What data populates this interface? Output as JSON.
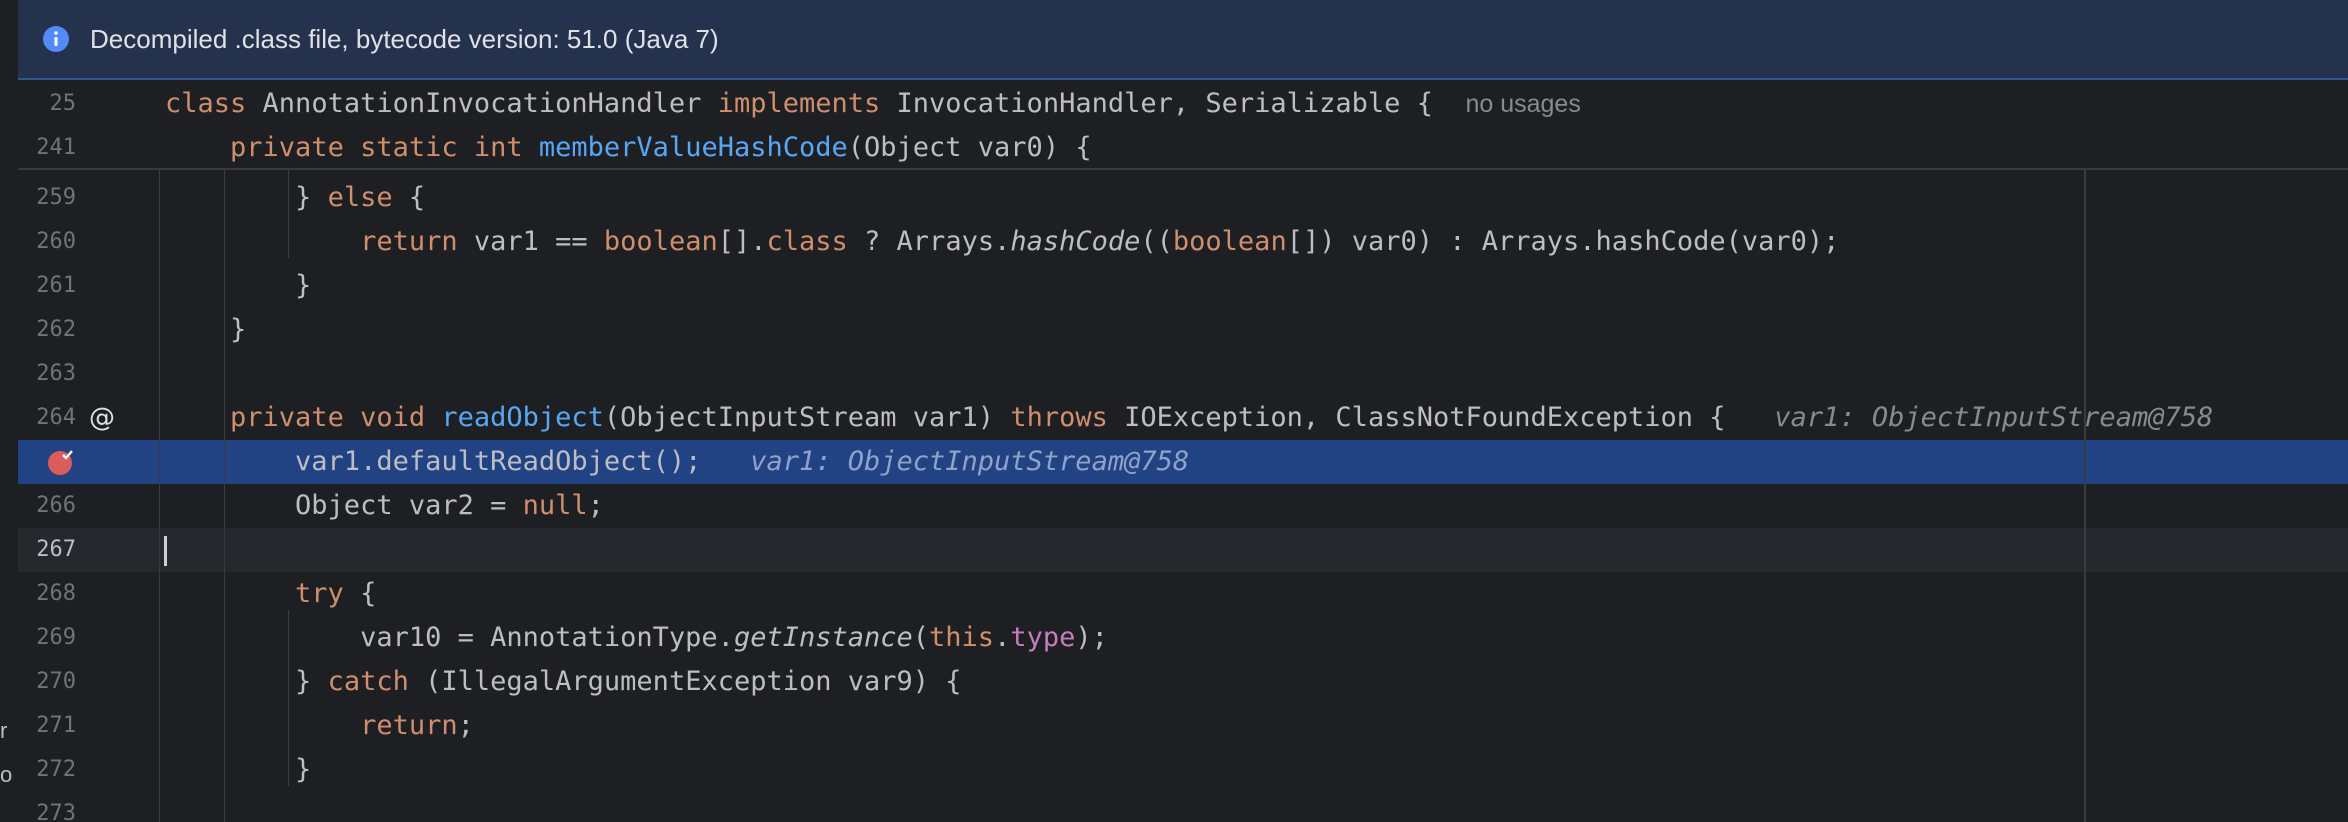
{
  "banner": {
    "icon": "info-icon",
    "text": "Decompiled .class file, bytecode version: 51.0 (Java 7)"
  },
  "sticky": [
    {
      "num": "25",
      "parts": [
        {
          "t": "class ",
          "c": "kw"
        },
        {
          "t": "AnnotationInvocationHandler "
        },
        {
          "t": "implements ",
          "c": "kw"
        },
        {
          "t": "InvocationHandler, Serializable {  "
        },
        {
          "t": "no usages",
          "c": "usage"
        }
      ]
    },
    {
      "num": "241",
      "parts": [
        {
          "t": "    "
        },
        {
          "t": "private static int ",
          "c": "kw"
        },
        {
          "t": "memberValueHashCode",
          "c": "fn"
        },
        {
          "t": "(Object var0) {"
        }
      ]
    }
  ],
  "lines": [
    {
      "num": "259",
      "parts": [
        {
          "t": "        } "
        },
        {
          "t": "else ",
          "c": "kw"
        },
        {
          "t": "{"
        }
      ]
    },
    {
      "num": "260",
      "parts": [
        {
          "t": "            "
        },
        {
          "t": "return ",
          "c": "kw"
        },
        {
          "t": "var1 == "
        },
        {
          "t": "boolean",
          "c": "kw"
        },
        {
          "t": "[]."
        },
        {
          "t": "class",
          "c": "kw"
        },
        {
          "t": " ? Arrays."
        },
        {
          "t": "hashCode",
          "c": "it"
        },
        {
          "t": "(("
        },
        {
          "t": "boolean",
          "c": "kw"
        },
        {
          "t": "[]) var0) : Arrays.hashCode(var0);"
        }
      ]
    },
    {
      "num": "261",
      "parts": [
        {
          "t": "        }"
        }
      ]
    },
    {
      "num": "262",
      "parts": [
        {
          "t": "    }"
        }
      ]
    },
    {
      "num": "263",
      "parts": []
    },
    {
      "num": "264",
      "icon": "at-override-icon",
      "parts": [
        {
          "t": "    "
        },
        {
          "t": "private void ",
          "c": "kw"
        },
        {
          "t": "readObject",
          "c": "fn"
        },
        {
          "t": "(ObjectInputStream var1) "
        },
        {
          "t": "throws ",
          "c": "kw"
        },
        {
          "t": "IOException, ClassNotFoundException {   "
        },
        {
          "t": "var1: ObjectInputStream@758",
          "c": "hint"
        }
      ]
    },
    {
      "num": "",
      "icon": "breakpoint-icon",
      "selected": true,
      "parts": [
        {
          "t": "        var1.defaultReadObject();   "
        },
        {
          "t": "var1: ObjectInputStream@758",
          "c": "hint"
        }
      ]
    },
    {
      "num": "266",
      "parts": [
        {
          "t": "        Object var2 = "
        },
        {
          "t": "null",
          "c": "kw"
        },
        {
          "t": ";"
        }
      ]
    },
    {
      "num": "267",
      "current": true,
      "parts": []
    },
    {
      "num": "268",
      "parts": [
        {
          "t": "        "
        },
        {
          "t": "try ",
          "c": "kw"
        },
        {
          "t": "{"
        }
      ]
    },
    {
      "num": "269",
      "parts": [
        {
          "t": "            var10 = AnnotationType."
        },
        {
          "t": "getInstance",
          "c": "it"
        },
        {
          "t": "("
        },
        {
          "t": "this",
          "c": "kw"
        },
        {
          "t": "."
        },
        {
          "t": "type",
          "c": "fld"
        },
        {
          "t": ");"
        }
      ]
    },
    {
      "num": "270",
      "parts": [
        {
          "t": "        } "
        },
        {
          "t": "catch ",
          "c": "kw"
        },
        {
          "t": "(IllegalArgumentException var9) {"
        }
      ]
    },
    {
      "num": "271",
      "parts": [
        {
          "t": "            "
        },
        {
          "t": "return",
          "c": "kw"
        },
        {
          "t": ";"
        }
      ]
    },
    {
      "num": "272",
      "parts": [
        {
          "t": "        }"
        }
      ]
    },
    {
      "num": "273",
      "parts": []
    }
  ],
  "left_strip": [
    "r",
    "o"
  ]
}
